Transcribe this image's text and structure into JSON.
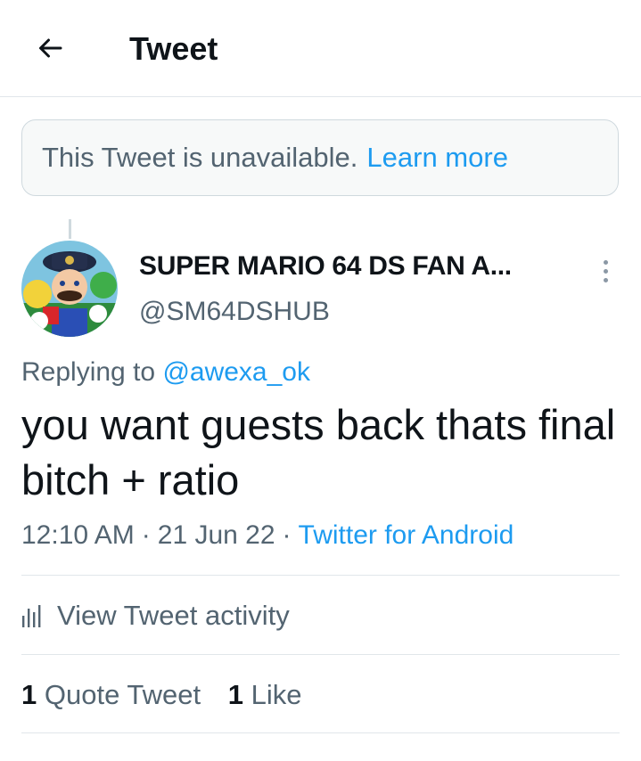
{
  "header": {
    "title": "Tweet",
    "back_icon": "arrow-left-icon"
  },
  "notice": {
    "text": "This Tweet is unavailable.",
    "link": "Learn more"
  },
  "tweet": {
    "author": {
      "display_name": "SUPER MARIO 64 DS FAN A...",
      "handle": "@SM64DSHUB"
    },
    "replying_prefix": "Replying to",
    "replying_to": "@awexa_ok",
    "text": "you want guests back thats final bitch + ratio",
    "time": "12:10 AM",
    "date": "21 Jun 22",
    "source": "Twitter for Android",
    "separator": "·"
  },
  "activity": {
    "label": "View Tweet activity",
    "icon": "bar-chart-icon"
  },
  "stats": {
    "quote_count": "1",
    "quote_label": "Quote Tweet",
    "like_count": "1",
    "like_label": "Like"
  },
  "colors": {
    "accent": "#1d9bf0",
    "text_primary": "#0f1419",
    "text_secondary": "#536471",
    "border": "#e1e6ea"
  }
}
